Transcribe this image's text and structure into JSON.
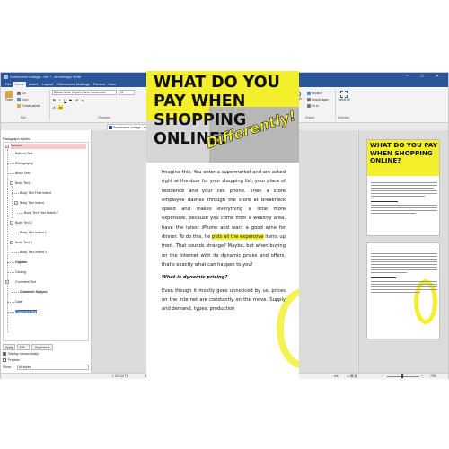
{
  "window": {
    "title": "Screenshot collage - en*.* - Archimage Write",
    "controls": [
      "–",
      "□",
      "✕"
    ]
  },
  "menu": [
    "File",
    "Home",
    "Insert",
    "Layout",
    "References",
    "Mailings",
    "Review",
    "View"
  ],
  "ribbon": {
    "paste": "Paste",
    "cut": "Cut",
    "copy": "Copy",
    "format_painter": "Format painter",
    "group_edit": "Edit",
    "font_name": "Bebas Neue DejaVu Sans Condensed",
    "font_size": "11",
    "group_character": "Character",
    "group_paragraph": "Paragraph",
    "style_preview": "AaBbCcDdEeFfGgHhIiJj",
    "style_name": "Normal",
    "group_styles": "Styles",
    "search": "Search",
    "replace": "Replace",
    "search_again": "Search again",
    "goto": "Go to",
    "group_search": "Search",
    "select_all": "Select all",
    "group_selection": "Selection"
  },
  "doctab": {
    "label": "Screenshot collage - en *",
    "close": "✕"
  },
  "sidebar": {
    "header": "Paragraph styles",
    "styles": [
      "Normal",
      "Balloon Text",
      "Bibliography",
      "Block Text",
      "Body Text",
      "Body Text First Indent",
      "Body Text Indent",
      "Body Text First Indent 2",
      "Body Text 2",
      "Body Text Indent 2",
      "Body Text 3",
      "Body Text Indent 3",
      "Caption",
      "Closing",
      "Comment Text",
      "Comment Subject",
      "Date",
      "Document Map"
    ],
    "btn_apply": "Apply",
    "btn_edit": "Edit...",
    "btn_organize": "Organize",
    "display_hierarchically": "Display hierarchically",
    "preview": "Preview",
    "show_label": "Show:",
    "show_value": "All styles"
  },
  "document": {
    "headline": "WHAT DO YOU PAY WHEN SHOPPING ONLINE?",
    "differently": "Differently!",
    "para1_a": "Imagine this: You enter a supermarket and are asked right at the door for your shopping list, your place of residence and your cell phone. Then a store employee dashes through the store at breakneck speed and makes everything a little more expensive, because you come from a wealthy area, have the latest iPhone and want a good wine for dinner. To do this, he ",
    "para1_hl": "puts all the expensive",
    "para1_b": " items up front. That sounds strange? Maybe, but when buying on the Internet with its dynamic prices and offers, that's exactly what can happen to you!",
    "subheading": "What is dynamic pricing?",
    "para2": "Even though it mostly goes unnoticed by us, prices on the Internet are constantly on the move. Supply and demand, types, production"
  },
  "status": {
    "position": "L 15 Col 71",
    "section": "Section 1",
    "chapter": "Chapter 1",
    "page": "Page 2 of 2",
    "language": "English (United States)",
    "words": "756 words",
    "mode": "Ins",
    "zoom": "75%"
  },
  "colors": {
    "accent": "#2b579a",
    "highlight_yellow": "#f3ef2a",
    "selected_style": "#f6c9cf"
  }
}
